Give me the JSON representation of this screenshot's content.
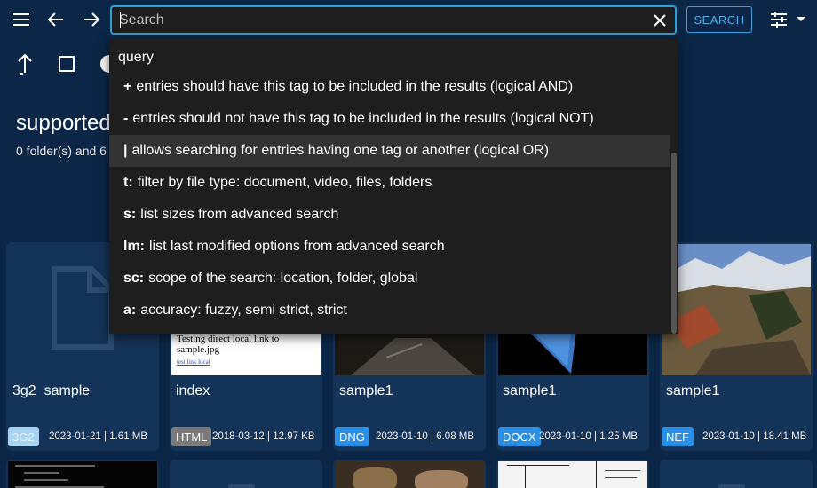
{
  "topbar": {
    "menu_icon": "menu-icon",
    "back_icon": "arrow-left-icon",
    "forward_icon": "arrow-right-icon",
    "search_placeholder": "Search",
    "search_value": "",
    "search_button": "SEARCH",
    "filter_icon": "tune-icon"
  },
  "toolbar": {
    "up_icon": "arrow-up-icon",
    "select_icon": "checkbox-icon",
    "info_icon": "info-icon"
  },
  "folder": {
    "title": "supported",
    "meta": "0 folder(s) and 6"
  },
  "dropdown": {
    "header": "query",
    "items": [
      {
        "key": "+",
        "text": "entries should have this tag to be included in the results (logical AND)"
      },
      {
        "key": "-",
        "text": "entries should not have this tag to be included in the results (logical NOT)"
      },
      {
        "key": "|",
        "text": "allows searching for entries having one tag or another (logical OR)"
      },
      {
        "key": "t:",
        "text": "filter by file type: document, video, files, folders"
      },
      {
        "key": "s:",
        "text": "list sizes from advanced search"
      },
      {
        "key": "lm:",
        "text": "list last modified options from advanced search"
      },
      {
        "key": "sc:",
        "text": "scope of the search: location, folder, global"
      },
      {
        "key": "a:",
        "text": "accuracy: fuzzy, semi strict, strict"
      }
    ],
    "highlighted_index": 2
  },
  "cards": [
    {
      "name": "3g2_sample",
      "ext": "3G2",
      "ext_color": "#a6d4f2",
      "date": "2023-01-21 | 1.61 MB"
    },
    {
      "name": "index",
      "ext": "HTML",
      "ext_color": "#7a7a7a",
      "date": "2018-03-12 | 12.97 KB",
      "thumb_text1": "Testing direct local link to sample.jpg",
      "thumb_text2": "test link local"
    },
    {
      "name": "sample1",
      "ext": "DNG",
      "ext_color": "#2b8fe6",
      "date": "2023-01-10 | 6.08 MB"
    },
    {
      "name": "sample1",
      "ext": "DOCX",
      "ext_color": "#2b8fe6",
      "date": "2023-01-10 | 1.25 MB"
    },
    {
      "name": "sample1",
      "ext": "NEF",
      "ext_color": "#2b8fe6",
      "date": "2023-01-10 | 18.41 MB"
    }
  ]
}
